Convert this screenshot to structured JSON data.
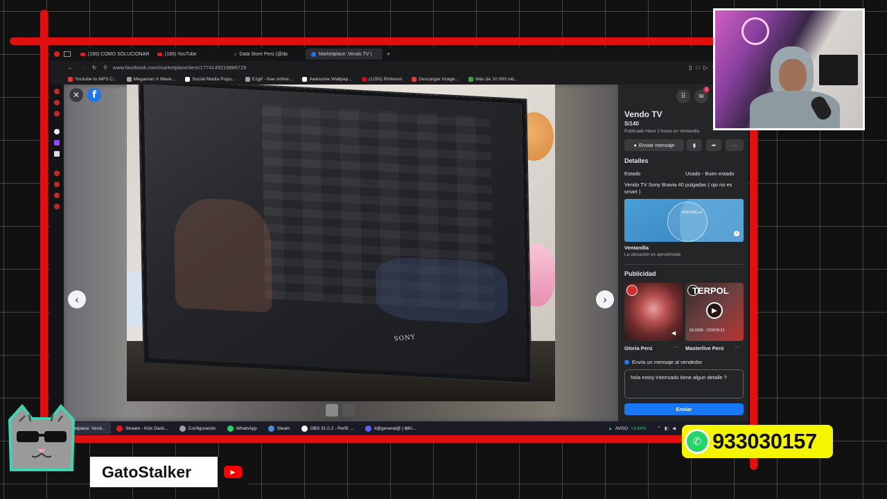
{
  "browser": {
    "tabs": [
      {
        "label": "(165) COMO SOLUCIONAR",
        "icon": "youtube-icon"
      },
      {
        "label": "(165) YouTube",
        "icon": "youtube-icon"
      },
      {
        "label": "Data Store Perú (@da",
        "icon": "tiktok-icon"
      },
      {
        "label": "Marketplace: Vendo TV |",
        "icon": "facebook-icon",
        "active": true
      }
    ],
    "new_tab": "+",
    "url": "www.facebook.com/marketplace/item/1774149219886729",
    "bookmarks": [
      {
        "label": "Youtube to MP3 C...",
        "color": "#e53935"
      },
      {
        "label": "Megaman X Mave...",
        "color": "#9e9e9e"
      },
      {
        "label": "Social Media Popu...",
        "color": "#ffffff"
      },
      {
        "label": "Ezgif - free online...",
        "color": "#9e9e9e"
      },
      {
        "label": "Awesome Wallpap...",
        "color": "#ffffff"
      },
      {
        "label": "(1250) Pinterest",
        "color": "#e60023"
      },
      {
        "label": "Descargar Image...",
        "color": "#e53935"
      },
      {
        "label": "Más de 10 000 vid...",
        "color": "#43a047"
      }
    ]
  },
  "viewer": {
    "close_symbol": "✕",
    "fb_letter": "f",
    "prev_symbol": "‹",
    "next_symbol": "›",
    "tv_brand": "SONY"
  },
  "listing": {
    "title": "Vendo TV",
    "price": "S/140",
    "published": "Publicado Hace 2 horas en Ventanilla",
    "message_button": "Enviar mensaje",
    "details_heading": "Detalles",
    "condition_label": "Estado",
    "condition_value": "Usado - Buen estado",
    "description": "Vendo TV Sony Bravia 40 pulgadas ( ojo no es smart )",
    "map_label": "VENTANILLA",
    "location": "Ventanilla",
    "location_note": "La ubicación es aproximada",
    "ads_heading": "Publicidad",
    "ads": [
      {
        "name": "Gloria Perú"
      },
      {
        "name": "Masterlive Perú",
        "headline": "TERPOL",
        "caption": "03.2026 · COSTA 21"
      }
    ],
    "send_to_seller": "Envía un mensaje al vendedor",
    "message_text": "hola estoy interrsado tiene algun detalle ?",
    "send_button": "Enviar",
    "messenger_badge": "5"
  },
  "taskbar": {
    "items": [
      {
        "label": "Marketplace: Vend...",
        "color": "#e02020",
        "active": true
      },
      {
        "label": "Stream - Kick Dash...",
        "color": "#e02020"
      },
      {
        "label": "Configuración",
        "color": "#9e9e9e"
      },
      {
        "label": "WhatsApp",
        "color": "#25d366"
      },
      {
        "label": "Steam",
        "color": "#4a90d9"
      },
      {
        "label": "OBS 31.0.2 - Perfil: ...",
        "color": "#ffffff"
      },
      {
        "label": "#@general@ | ⊞Kl...",
        "color": "#5865f2"
      }
    ],
    "ticker": "AVGO",
    "ticker_change": "+3.84%"
  },
  "overlay": {
    "channel_name": "GatoStalker",
    "phone": "933030157"
  },
  "colors": {
    "frame_red": "#e01010",
    "facebook_blue": "#1877f2",
    "whatsapp_green": "#25d366",
    "badge_yellow": "#f5f500"
  }
}
